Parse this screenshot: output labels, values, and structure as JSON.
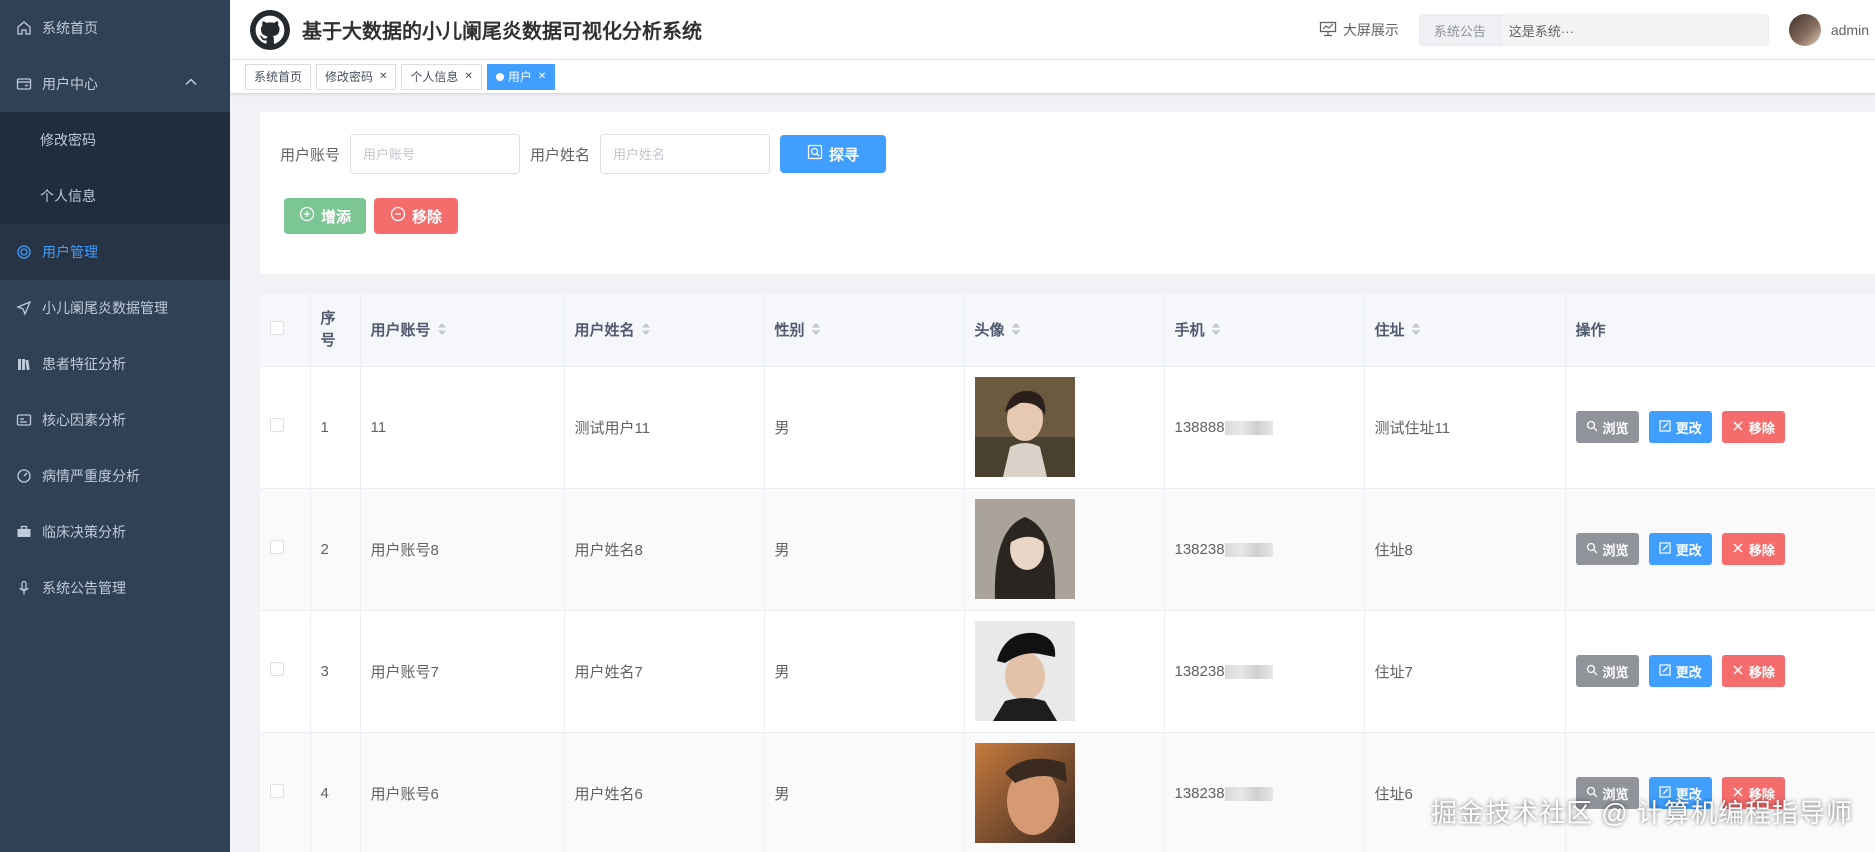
{
  "sidebar": {
    "items": [
      {
        "label": "系统首页",
        "icon": "home-icon"
      },
      {
        "label": "用户中心",
        "icon": "wallet-icon"
      },
      {
        "label": "修改密码"
      },
      {
        "label": "个人信息"
      },
      {
        "label": "用户管理",
        "icon": "target-icon"
      },
      {
        "label": "小儿阑尾炎数据管理",
        "icon": "send-icon"
      },
      {
        "label": "患者特征分析",
        "icon": "books-icon"
      },
      {
        "label": "核心因素分析",
        "icon": "id-card-icon"
      },
      {
        "label": "病情严重度分析",
        "icon": "gauge-icon"
      },
      {
        "label": "临床决策分析",
        "icon": "briefcase-icon"
      },
      {
        "label": "系统公告管理",
        "icon": "mic-icon"
      }
    ]
  },
  "header": {
    "title": "基于大数据的小儿阑尾炎数据可视化分析系统",
    "big_screen": "大屏展示",
    "notice_label": "系统公告",
    "notice_text": "这是系统···",
    "username": "admin"
  },
  "tags": [
    {
      "label": "系统首页"
    },
    {
      "label": "修改密码"
    },
    {
      "label": "个人信息"
    },
    {
      "label": "用户"
    }
  ],
  "search": {
    "account_label": "用户账号",
    "account_placeholder": "用户账号",
    "name_label": "用户姓名",
    "name_placeholder": "用户姓名",
    "search_button": "探寻",
    "add_button": "增添",
    "delete_button": "移除"
  },
  "table": {
    "headers": [
      "序号",
      "用户账号",
      "用户姓名",
      "性别",
      "头像",
      "手机",
      "住址",
      "操作"
    ],
    "rows": [
      {
        "index": "1",
        "account": "11",
        "name": "测试用户11",
        "gender": "男",
        "phone": "138888",
        "address": "测试住址11"
      },
      {
        "index": "2",
        "account": "用户账号8",
        "name": "用户姓名8",
        "gender": "男",
        "phone": "138238",
        "address": "住址8"
      },
      {
        "index": "3",
        "account": "用户账号7",
        "name": "用户姓名7",
        "gender": "男",
        "phone": "138238",
        "address": "住址7"
      },
      {
        "index": "4",
        "account": "用户账号6",
        "name": "用户姓名6",
        "gender": "男",
        "phone": "138238",
        "address": "住址6"
      }
    ],
    "ops": {
      "view": "浏览",
      "edit": "更改",
      "delete": "移除"
    }
  },
  "watermark": "掘金技术社区 @ 计算机编程指导师",
  "colors": {
    "sidebar_bg": "#304156",
    "primary": "#409eff",
    "danger": "#f56c6c",
    "success": "#5cb87a",
    "info": "#909399"
  }
}
